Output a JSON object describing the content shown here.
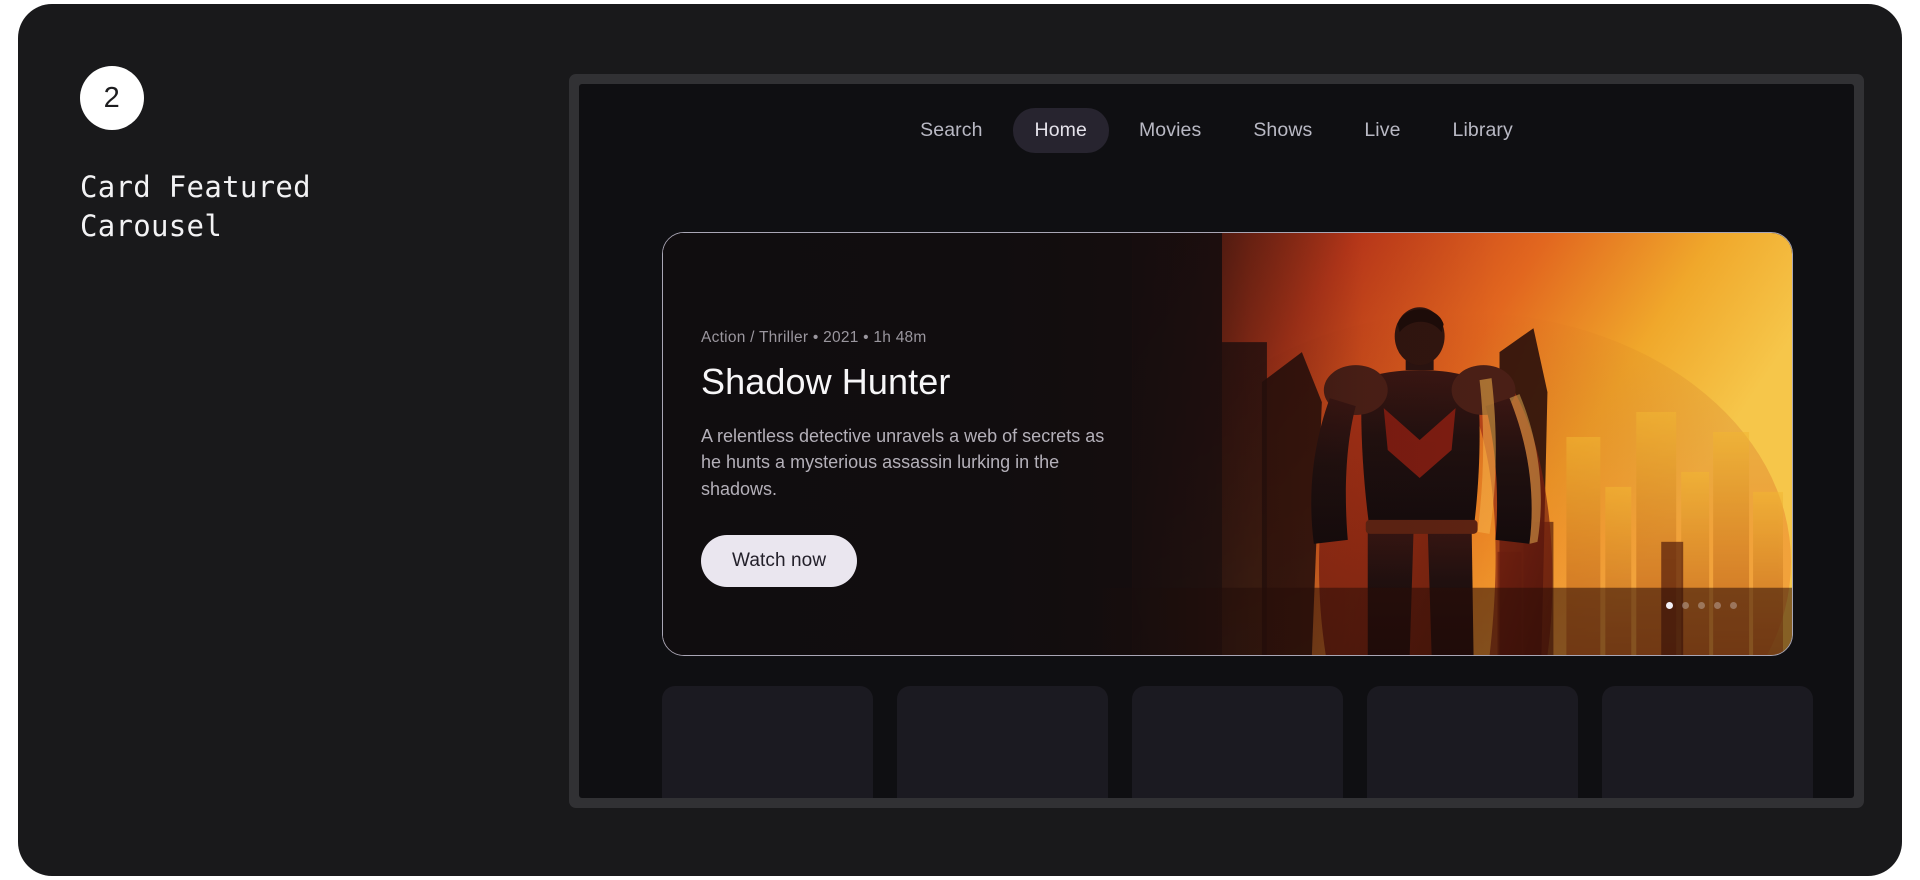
{
  "annotation": {
    "step_number": "2",
    "title": "Card Featured\nCarousel"
  },
  "app": {
    "nav": {
      "items": [
        {
          "label": "Search",
          "active": false
        },
        {
          "label": "Home",
          "active": true
        },
        {
          "label": "Movies",
          "active": false
        },
        {
          "label": "Shows",
          "active": false
        },
        {
          "label": "Live",
          "active": false
        },
        {
          "label": "Library",
          "active": false
        }
      ]
    },
    "hero": {
      "meta": "Action / Thriller • 2021 • 1h 48m",
      "title": "Shadow Hunter",
      "description": "A relentless detective unravels a web of secrets as he hunts a mysterious assassin lurking in the shadows.",
      "cta_label": "Watch now",
      "carousel": {
        "total_slides": 5,
        "active_slide": 1
      }
    },
    "thumbnails": {
      "count": 5
    }
  },
  "colors": {
    "page_background": "#ffffff",
    "canvas_background": "#19191b",
    "screen_background": "#0f0f12",
    "device_frame": "#313134",
    "nav_active_pill": "#27242f",
    "nav_text": "#b9b9c4",
    "hero_border": "#a9a6b5",
    "cta_background": "#eae6ef",
    "cta_text": "#23202a",
    "badge_background": "#ffffff",
    "title_text": "#f2f2f4",
    "thumb_background": "#1b1a21",
    "hero_art_accent": "#e2521f"
  }
}
